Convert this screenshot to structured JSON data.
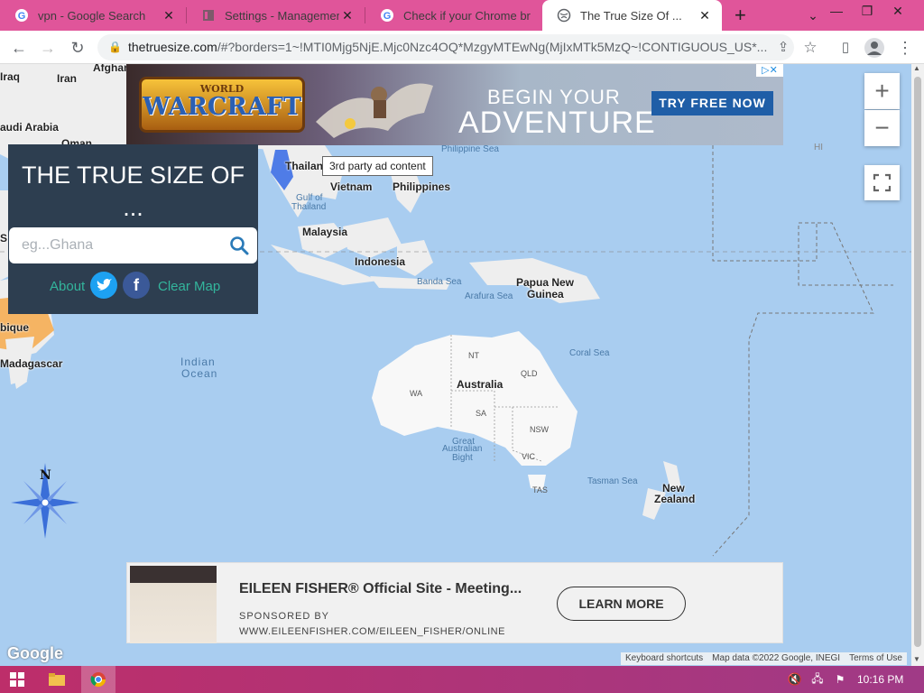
{
  "browser": {
    "tabs": [
      {
        "title": "vpn - Google Search",
        "icon": "google-icon",
        "active": false
      },
      {
        "title": "Settings - Management",
        "icon": "settings-page-icon",
        "active": false
      },
      {
        "title": "Check if your Chrome br",
        "icon": "google-icon",
        "active": false
      },
      {
        "title": "The True Size Of ...",
        "icon": "globe-icon",
        "active": true
      }
    ],
    "new_tab_label": "+",
    "url_host": "thetruesize.com",
    "url_path": "/#?borders=1~!MTI0Mjg5NjE.Mjc0Nzc4OQ*MzgyMTEwNg(MjIxMTk5MzQ~!CONTIGUOUS_US*..."
  },
  "ads": {
    "top": {
      "logo_line1": "WORLD",
      "logo_line2": "WARCRAFT",
      "headline1": "BEGIN YOUR",
      "headline2": "ADVENTURE",
      "cta": "TRY FREE NOW",
      "tooltip": "3rd party ad content"
    },
    "bottom": {
      "title": "EILEEN FISHER® Official Site - Meeting...",
      "sponsor": "SPONSORED BY",
      "url": "WWW.EILEENFISHER.COM/EILEEN_FISHER/ONLINE",
      "cta": "LEARN MORE"
    }
  },
  "sidebar": {
    "heading": "THE TRUE SIZE OF ...",
    "search_placeholder": "eg...Ghana",
    "about": "About",
    "clear_map": "Clear Map",
    "twitter_glyph": "t",
    "facebook_glyph": "f"
  },
  "map": {
    "countries": {
      "iraq": "Iraq",
      "iran": "Iran",
      "afghan": "Afghan",
      "saudi": "audi Arabia",
      "oman": "Oman",
      "thailand": "Thailand",
      "vietnam": "Vietnam",
      "philippines": "Philippines",
      "malaysia": "Malaysia",
      "indonesia": "Indonesia",
      "png1": "Papua New",
      "png2": "Guinea",
      "australia": "Australia",
      "nz1": "New",
      "nz2": "Zealand",
      "madagascar": "Madagascar",
      "mozambique": "bique",
      "s_fragment": "S"
    },
    "seas": {
      "philippine": "Philippine Sea",
      "gulf1": "Gulf of",
      "gulf2": "Thailand",
      "banda": "Banda Sea",
      "arafura": "Arafura Sea",
      "coral": "Coral Sea",
      "tasman": "Tasman Sea",
      "gab1": "Great",
      "gab2": "Australian",
      "gab3": "Bight",
      "indian1": "Indian",
      "indian2": "Ocean",
      "hi": "HI"
    },
    "states": {
      "nt": "NT",
      "qld": "QLD",
      "wa": "WA",
      "sa": "SA",
      "nsw": "NSW",
      "vic": "VIC",
      "tas": "TAS"
    },
    "compass_n": "N",
    "zoom_in": "+",
    "zoom_out": "−",
    "google": "Google",
    "footer": {
      "shortcuts": "Keyboard shortcuts",
      "data": "Map data ©2022 Google, INEGI",
      "terms": "Terms of Use"
    }
  },
  "taskbar": {
    "clock": "10:16 PM"
  },
  "colors": {
    "tabstrip": "#e0559a",
    "sidebar": "#2d3e50",
    "accent_teal": "#33b59c",
    "ocean": "#aadaff",
    "taskbar": "#bd2e6a"
  }
}
